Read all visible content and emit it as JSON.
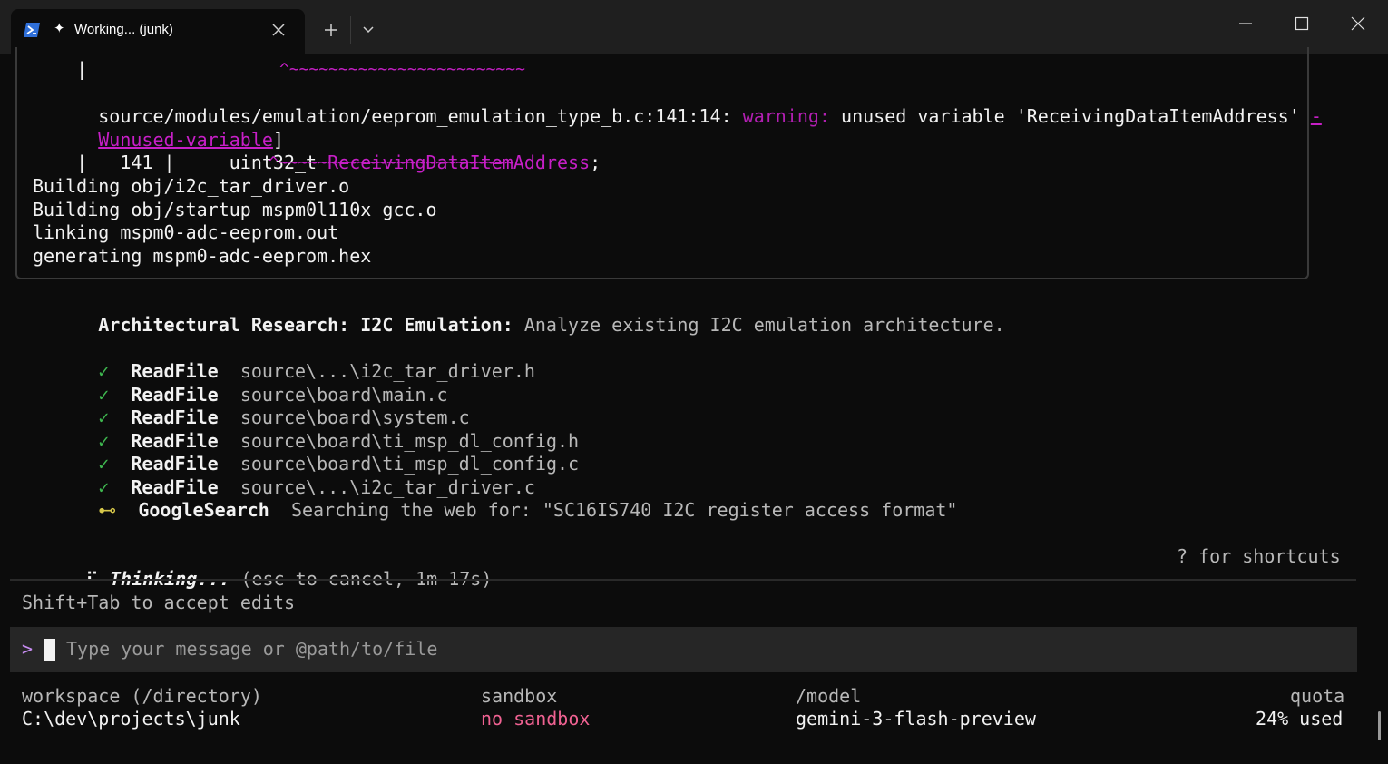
{
  "tab": {
    "title": "Working... (junk)",
    "spark": "✦"
  },
  "icons": {
    "powershell": "powershell-icon",
    "close": "close-icon",
    "plus": "plus-icon",
    "chevron": "chevron-down-icon",
    "minimize": "minimize-icon",
    "maximize": "maximize-icon",
    "window_close": "close-icon"
  },
  "colors": {
    "background": "#0c0c0c",
    "titlebar": "#1f1f1f",
    "warning": "#b21fb2",
    "variable": "#c71fc7",
    "success": "#3fb950",
    "sandbox": "#f06292"
  },
  "build_output": {
    "pipe_line_1": "    |",
    "carets_1": "^~~~~~~~~~~~~~~~~~~~~~~~~",
    "warning_location": "source/modules/emulation/eeprom_emulation_type_b.c:141:14: ",
    "warning_label": "warning:",
    "warning_message": " unused variable 'ReceivingDataItemAddress' ",
    "warning_flag_dash": "-",
    "warning_flag": "Wunused-variable",
    "warning_flag_close": "]",
    "code_line_number": "  141 |     uint32_t ",
    "code_variable": "ReceivingDataItemAddress",
    "code_semicolon": ";",
    "pipe_line_2": "    |",
    "carets_2": "^~~~~~~~~~~~~~~~~~~~~~~~~",
    "lines": [
      "Building obj/i2c_tar_driver.o",
      "Building obj/startup_mspm0l110x_gcc.o",
      "linking mspm0-adc-eeprom.out",
      "generating mspm0-adc-eeprom.hex"
    ]
  },
  "research": {
    "heading": "Architectural Research: I2C Emulation:",
    "description": " Analyze existing I2C emulation architecture."
  },
  "tool_calls": [
    {
      "status": "✓",
      "tool": "ReadFile",
      "detail": "source\\...\\i2c_tar_driver.h"
    },
    {
      "status": "✓",
      "tool": "ReadFile",
      "detail": "source\\board\\main.c"
    },
    {
      "status": "✓",
      "tool": "ReadFile",
      "detail": "source\\board\\system.c"
    },
    {
      "status": "✓",
      "tool": "ReadFile",
      "detail": "source\\board\\ti_msp_dl_config.h"
    },
    {
      "status": "✓",
      "tool": "ReadFile",
      "detail": "source\\board\\ti_msp_dl_config.c"
    },
    {
      "status": "✓",
      "tool": "ReadFile",
      "detail": "source\\...\\i2c_tar_driver.c"
    },
    {
      "status": "⊷",
      "tool": "GoogleSearch",
      "detail": "Searching the web for: \"SC16IS740 I2C register access format\""
    }
  ],
  "thinking": {
    "spinner": "⠋",
    "label": "Thinking...",
    "detail": " (esc to cancel, 1m 17s)",
    "shortcuts_hint": "? for shortcuts"
  },
  "accept_hint": "Shift+Tab to accept edits",
  "input": {
    "prompt": ">",
    "placeholder": "Type your message or @path/to/file"
  },
  "footer": {
    "workspace_label": "workspace (/directory)",
    "workspace_value": "C:\\dev\\projects\\junk",
    "sandbox_label": "sandbox",
    "sandbox_value": "no sandbox",
    "model_label": "/model",
    "model_value": "gemini-3-flash-preview",
    "quota_label": "quota",
    "quota_value": "24% used"
  }
}
